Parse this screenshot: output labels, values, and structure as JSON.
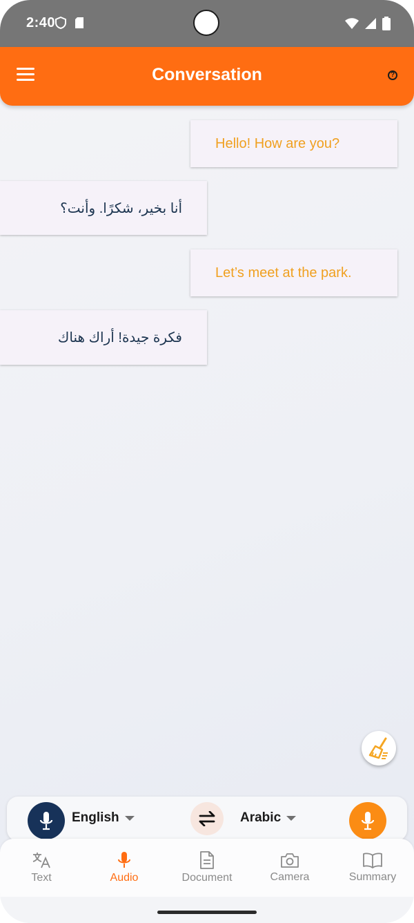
{
  "status_bar": {
    "time": "2:40"
  },
  "app_bar": {
    "title": "Conversation"
  },
  "messages": [
    {
      "side": "sent",
      "text": "Hello! How are you?"
    },
    {
      "side": "received",
      "text": "أنا بخير، شكرًا. وأنت؟"
    },
    {
      "side": "sent",
      "text": "Let’s meet at the park."
    },
    {
      "side": "received",
      "text": "فكرة جيدة! أراك هناك"
    }
  ],
  "language_bar": {
    "source_language": "English",
    "target_language": "Arabic"
  },
  "bottom_nav": {
    "items": [
      {
        "label": "Text",
        "icon": "translate-icon"
      },
      {
        "label": "Audio",
        "icon": "mic-icon",
        "active": true
      },
      {
        "label": "Document",
        "icon": "document-icon"
      },
      {
        "label": "Camera",
        "icon": "camera-icon"
      },
      {
        "label": "Summary",
        "icon": "book-icon"
      }
    ]
  },
  "colors": {
    "primary": "#ff6d12",
    "sent_text": "#f0a020",
    "received_text": "#1c3550",
    "mic_left": "#173259",
    "mic_right": "#fb8c14"
  }
}
